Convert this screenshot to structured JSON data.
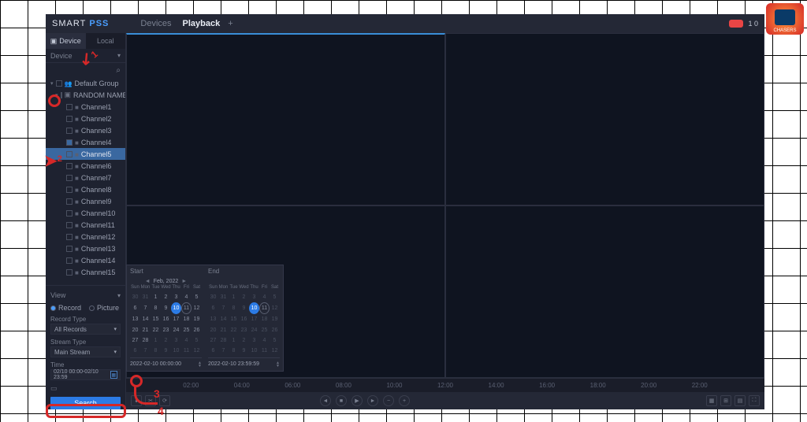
{
  "header": {
    "logo_a": "SMART",
    "logo_b": " PSS",
    "tab_devices": "Devices",
    "tab_playback": "Playback",
    "top_right": "1 0"
  },
  "sidebar": {
    "tab_device": "Device",
    "tab_local": "Local",
    "device_label": "Device",
    "tree": {
      "group": "Default Group",
      "device": "RANDOM NAME",
      "channels": [
        "Channel1",
        "Channel2",
        "Channel3",
        "Channel4",
        "Channel5",
        "Channel6",
        "Channel7",
        "Channel8",
        "Channel9",
        "Channel10",
        "Channel11",
        "Channel12",
        "Channel13",
        "Channel14",
        "Channel15"
      ]
    }
  },
  "lower": {
    "view": "View",
    "record": "Record",
    "picture": "Picture",
    "record_type_lbl": "Record Type",
    "record_type_val": "All Records",
    "stream_type_lbl": "Stream Type",
    "stream_type_val": "Main Stream",
    "time_lbl": "Time",
    "time_val": "02/10 00:00-02/10 23:59",
    "search": "Search"
  },
  "calendar": {
    "start_lbl": "Start",
    "end_lbl": "End",
    "month": "Feb, 2022",
    "dow": [
      "Sun",
      "Mon",
      "Tue",
      "Wed",
      "Thu",
      "Fri",
      "Sat"
    ],
    "start_cells": [
      {
        "v": "30",
        "d": 1
      },
      {
        "v": "31",
        "d": 1
      },
      {
        "v": "1"
      },
      {
        "v": "2"
      },
      {
        "v": "3"
      },
      {
        "v": "4"
      },
      {
        "v": "5"
      },
      {
        "v": "6"
      },
      {
        "v": "7"
      },
      {
        "v": "8"
      },
      {
        "v": "9"
      },
      {
        "v": "10",
        "sel": 1
      },
      {
        "v": "11",
        "today": 1
      },
      {
        "v": "12"
      },
      {
        "v": "13"
      },
      {
        "v": "14"
      },
      {
        "v": "15"
      },
      {
        "v": "16"
      },
      {
        "v": "17"
      },
      {
        "v": "18"
      },
      {
        "v": "19"
      },
      {
        "v": "20"
      },
      {
        "v": "21"
      },
      {
        "v": "22"
      },
      {
        "v": "23"
      },
      {
        "v": "24"
      },
      {
        "v": "25"
      },
      {
        "v": "26"
      },
      {
        "v": "27"
      },
      {
        "v": "28"
      },
      {
        "v": "1",
        "d": 1
      },
      {
        "v": "2",
        "d": 1
      },
      {
        "v": "3",
        "d": 1
      },
      {
        "v": "4",
        "d": 1
      },
      {
        "v": "5",
        "d": 1
      },
      {
        "v": "6",
        "d": 1
      },
      {
        "v": "7",
        "d": 1
      },
      {
        "v": "8",
        "d": 1
      },
      {
        "v": "9",
        "d": 1
      },
      {
        "v": "10",
        "d": 1
      },
      {
        "v": "11",
        "d": 1
      },
      {
        "v": "12",
        "d": 1
      }
    ],
    "end_cells": [
      {
        "v": "30",
        "d": 1
      },
      {
        "v": "31",
        "d": 1
      },
      {
        "v": "1",
        "d": 1
      },
      {
        "v": "2",
        "d": 1
      },
      {
        "v": "3",
        "d": 1
      },
      {
        "v": "4",
        "d": 1
      },
      {
        "v": "5",
        "d": 1
      },
      {
        "v": "6",
        "d": 1
      },
      {
        "v": "7",
        "d": 1
      },
      {
        "v": "8",
        "d": 1
      },
      {
        "v": "9",
        "d": 1
      },
      {
        "v": "10",
        "sel": 1
      },
      {
        "v": "11",
        "today": 1
      },
      {
        "v": "12",
        "d": 1
      },
      {
        "v": "13",
        "d": 1
      },
      {
        "v": "14",
        "d": 1
      },
      {
        "v": "15",
        "d": 1
      },
      {
        "v": "16",
        "d": 1
      },
      {
        "v": "17",
        "d": 1
      },
      {
        "v": "18",
        "d": 1
      },
      {
        "v": "19",
        "d": 1
      },
      {
        "v": "20",
        "d": 1
      },
      {
        "v": "21",
        "d": 1
      },
      {
        "v": "22",
        "d": 1
      },
      {
        "v": "23",
        "d": 1
      },
      {
        "v": "24",
        "d": 1
      },
      {
        "v": "25",
        "d": 1
      },
      {
        "v": "26",
        "d": 1
      },
      {
        "v": "27",
        "d": 1
      },
      {
        "v": "28",
        "d": 1
      },
      {
        "v": "1",
        "d": 1
      },
      {
        "v": "2",
        "d": 1
      },
      {
        "v": "3",
        "d": 1
      },
      {
        "v": "4",
        "d": 1
      },
      {
        "v": "5",
        "d": 1
      },
      {
        "v": "6",
        "d": 1
      },
      {
        "v": "7",
        "d": 1
      },
      {
        "v": "8",
        "d": 1
      },
      {
        "v": "9",
        "d": 1
      },
      {
        "v": "10",
        "d": 1
      },
      {
        "v": "11",
        "d": 1
      },
      {
        "v": "12",
        "d": 1
      }
    ],
    "start_time": "2022-02-10 00:00:00",
    "end_time": "2022-02-10 23:59:59"
  },
  "timeline": [
    "02:00",
    "04:00",
    "06:00",
    "08:00",
    "10:00",
    "12:00",
    "14:00",
    "16:00",
    "18:00",
    "20:00",
    "22:00"
  ],
  "overlay_label": "CHASERS"
}
